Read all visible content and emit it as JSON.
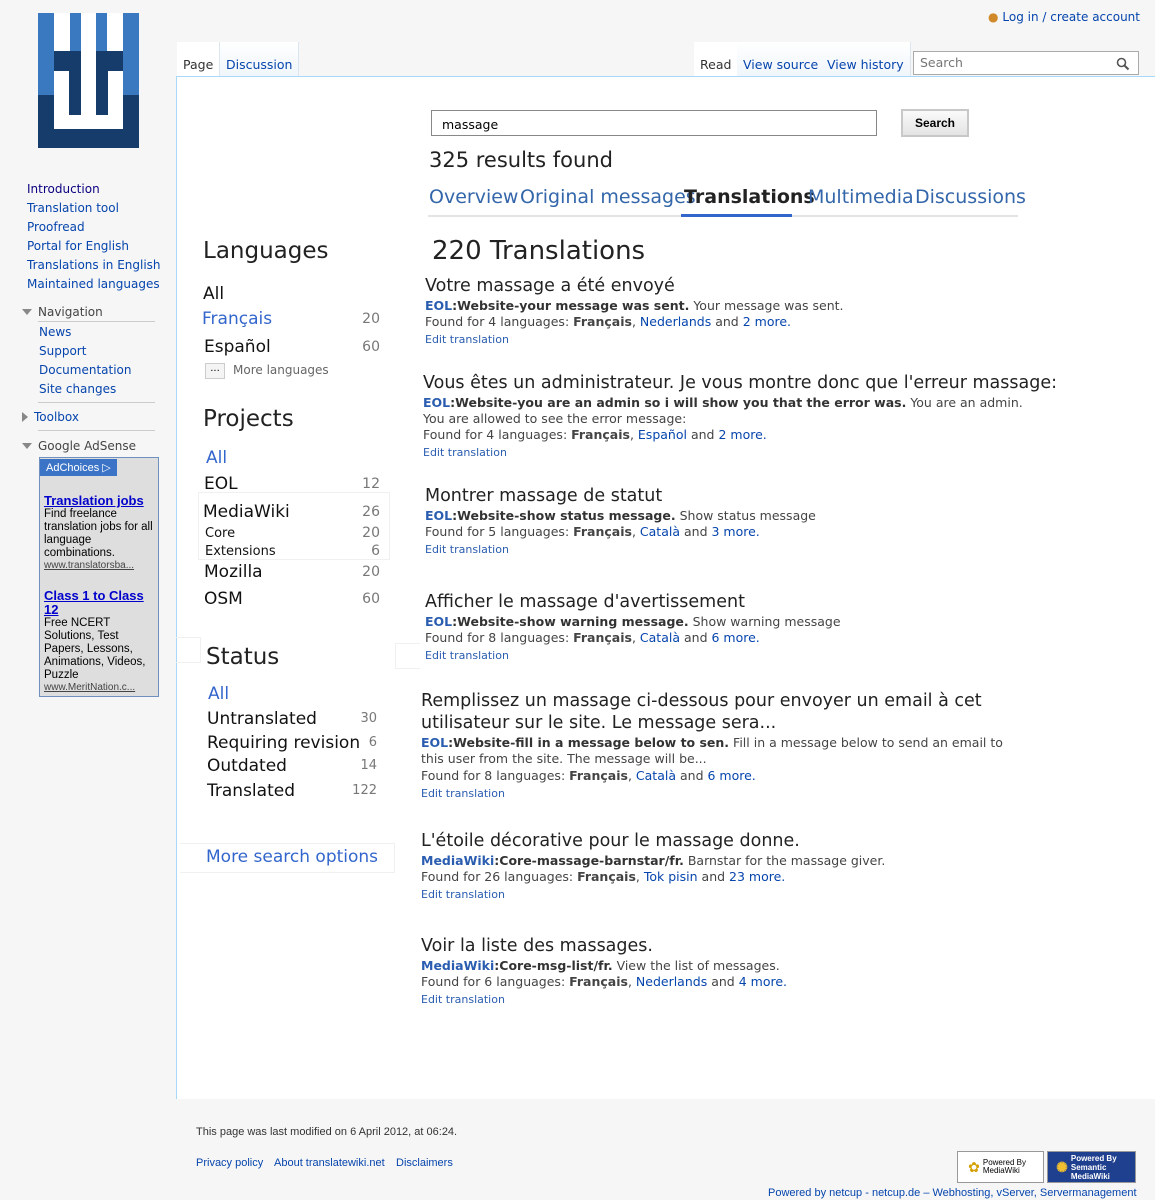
{
  "header": {
    "login": "Log in / create account",
    "search_placeholder": "Search"
  },
  "tabs": {
    "page": "Page",
    "discussion": "Discussion",
    "read": "Read",
    "view_source": "View source",
    "view_history": "View history"
  },
  "sidebar": {
    "links": [
      "Introduction",
      "Translation tool",
      "Proofread",
      "Portal for English",
      "Translations in English",
      "Maintained languages"
    ],
    "navigation": {
      "heading": "Navigation",
      "items": [
        "News",
        "Support",
        "Documentation",
        "Site changes"
      ]
    },
    "toolbox": "Toolbox",
    "adsense": "Google AdSense"
  },
  "ad": {
    "choices": "AdChoices",
    "ad1": {
      "title": "Translation jobs",
      "body": "Find freelance translation jobs for all language combinations.",
      "url": "www.translatorsba..."
    },
    "ad2": {
      "title": "Class 1 to Class 12",
      "body": "Free NCERT Solutions, Test Papers, Lessons, Animations, Videos, Puzzle",
      "url": "www.MeritNation.c..."
    }
  },
  "search": {
    "query": "massage",
    "button": "Search",
    "count": "325 results found",
    "tabs": [
      "Overview",
      "Original messages",
      "Translations",
      "Multimedia",
      "Discussions"
    ],
    "selected_tab": "Translations"
  },
  "facets": {
    "languages": {
      "heading": "Languages",
      "all": "All",
      "items": [
        {
          "label": "Français",
          "count": "20"
        },
        {
          "label": "Español",
          "count": "60"
        }
      ],
      "more": "More languages",
      "more_icon": "..."
    },
    "projects": {
      "heading": "Projects",
      "all": "All",
      "eol": {
        "label": "EOL",
        "count": "12"
      },
      "mediawiki": {
        "label": "MediaWiki",
        "count": "26"
      },
      "core": {
        "label": "Core",
        "count": "20"
      },
      "extensions": {
        "label": "Extensions",
        "count": "6"
      },
      "mozilla": {
        "label": "Mozilla",
        "count": "20"
      },
      "osm": {
        "label": "OSM",
        "count": "60"
      }
    },
    "status": {
      "heading": "Status",
      "all": "All",
      "items": [
        {
          "label": "Untranslated",
          "count": "30"
        },
        {
          "label": "Requiring revision",
          "count": "6"
        },
        {
          "label": "Outdated",
          "count": "14"
        },
        {
          "label": "Translated",
          "count": "122"
        }
      ]
    },
    "more_options": "More search options"
  },
  "results": {
    "heading": "220 Translations",
    "edit_label": "Edit translation",
    "items": [
      {
        "title": "Votre massage a été envoyé",
        "key_prefix": "EOL",
        "key": ":Website-your message was sent.",
        "desc": "Your message was sent.",
        "found_prefix": "Found for 4 languages:",
        "lang1": "Français",
        "lang2": "Nederlands",
        "and": "and",
        "more": "2 more."
      },
      {
        "title": "Vous êtes un administrateur. Je vous montre donc que l'erreur massage:",
        "key_prefix": "EOL",
        "key": ":Website-you are an admin so i will show you that the error was.",
        "desc": "You are an admin. You are allowed to see the error message:",
        "found_prefix": "Found for 4 languages:",
        "lang1": "Français",
        "lang2": "Español",
        "and": "and",
        "more": "2 more."
      },
      {
        "title": "Montrer massage de statut",
        "key_prefix": "EOL",
        "key": ":Website-show status message.",
        "desc": "Show status message",
        "found_prefix": "Found for 5 languages:",
        "lang1": "Français",
        "lang2": "Català",
        "and": "and",
        "more": "3 more."
      },
      {
        "title": "Afficher le  massage d'avertissement",
        "key_prefix": "EOL",
        "key": ":Website-show warning message.",
        "desc": "Show warning message",
        "found_prefix": "Found for 8 languages:",
        "lang1": "Français",
        "lang2": "Català",
        "and": "and",
        "more": "6 more."
      },
      {
        "title": "Remplissez un   massage ci-dessous pour envoyer un email à cet",
        "title2": "utilisateur sur le site. Le message sera...",
        "key_prefix": "EOL",
        "key": ":Website-fill in a message below to sen.",
        "desc": "Fill in a message below to send an email to this user from the site. The message will be...",
        "found_prefix": "Found for 8 languages:",
        "lang1": "Français",
        "lang2": "Català",
        "and": "and",
        "more": "6 more."
      },
      {
        "title": "L'étoile décorative pour le massage donne.",
        "key_prefix": "MediaWiki",
        "key": ":Core-massage-barnstar/fr.",
        "desc": "Barnstar for the massage giver.",
        "found_prefix": "Found for 26 languages:",
        "lang1": "Français",
        "lang2": "Tok pisin",
        "and": "and",
        "more": "23 more."
      },
      {
        "title": "Voir la liste des massages.",
        "key_prefix": "MediaWiki",
        "key": ":Core-msg-list/fr.",
        "desc": "View the list of messages.",
        "found_prefix": "Found for 6 languages:",
        "lang1": "Français",
        "lang2": "Nederlands",
        "and": "and",
        "more": "4 more."
      }
    ]
  },
  "footer": {
    "modified": "This page was last modified on 6 April 2012, at 06:24.",
    "links": [
      "Privacy policy",
      "About translatewiki.net",
      "Disclaimers"
    ],
    "powered_mw": "Powered By MediaWiki",
    "powered_smw": "Powered By Semantic MediaWiki",
    "hosting": "Powered by netcup - netcup.de – Webhosting, vServer, Servermanagement"
  },
  "colors": {
    "logo_light": "#3a79c0",
    "logo_dark": "#163c6c",
    "link": "#0645ad",
    "facet_blue": "#3366cc"
  }
}
